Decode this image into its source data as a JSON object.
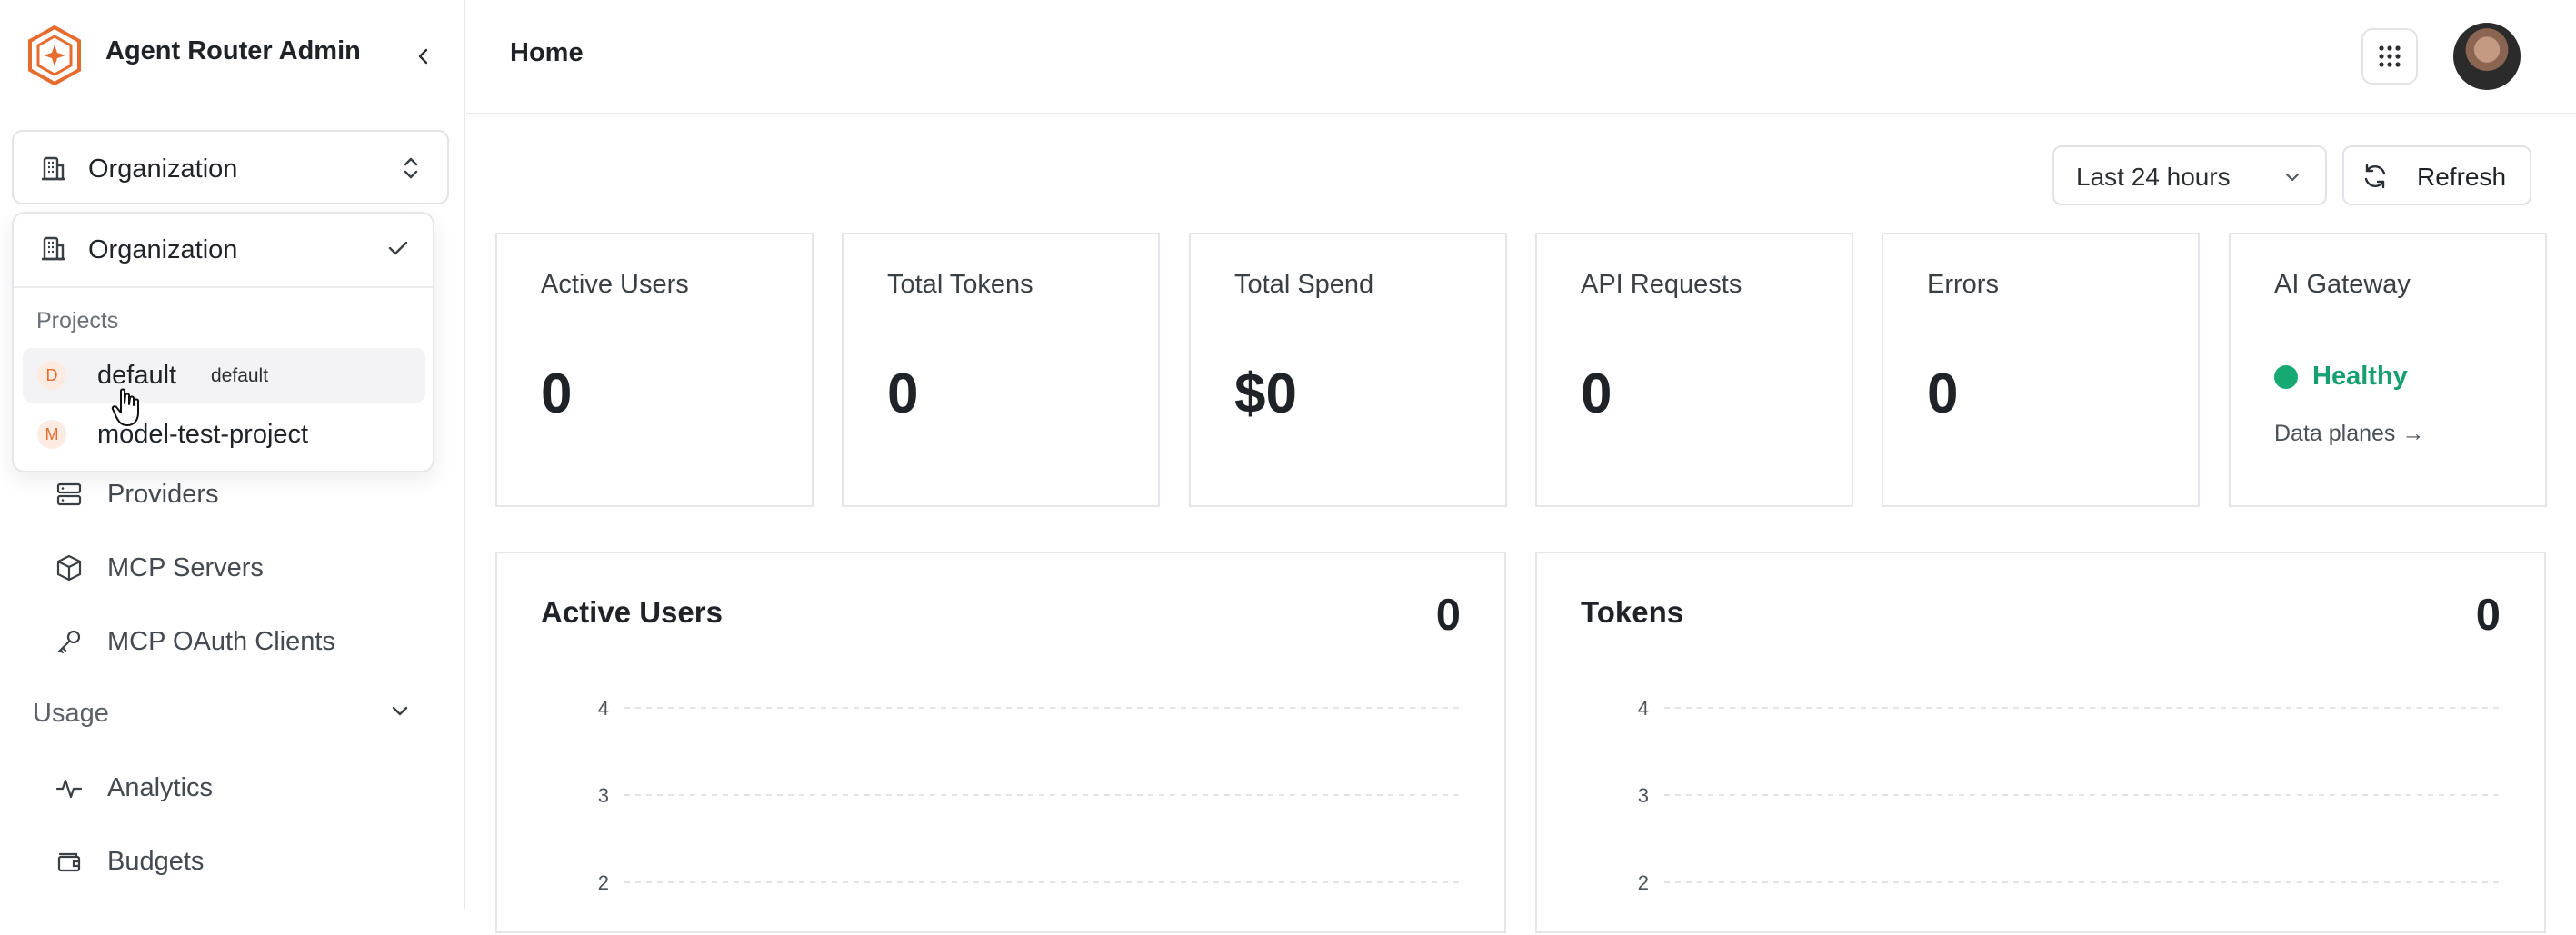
{
  "app": {
    "title": "Agent Router Admin",
    "brand_color": "#e56b2f"
  },
  "sidebar": {
    "scope_selector": {
      "value": "Organization"
    },
    "scope_menu": {
      "organization_label": "Organization",
      "projects_heading": "Projects",
      "projects": [
        {
          "initial": "D",
          "name": "default",
          "tag": "default",
          "active": true
        },
        {
          "initial": "M",
          "name": "model-test-project",
          "tag": "",
          "active": false
        }
      ]
    },
    "items": [
      {
        "label": "Providers",
        "icon": "server-icon"
      },
      {
        "label": "MCP Servers",
        "icon": "box-icon"
      },
      {
        "label": "MCP OAuth Clients",
        "icon": "key-icon"
      }
    ],
    "usage_group": {
      "label": "Usage",
      "items": [
        {
          "label": "Analytics",
          "icon": "activity-icon"
        },
        {
          "label": "Budgets",
          "icon": "wallet-icon"
        }
      ]
    }
  },
  "header": {
    "page_title": "Home"
  },
  "toolbar": {
    "time_range": "Last 24 hours",
    "refresh_label": "Refresh"
  },
  "kpis": [
    {
      "title": "Active Users",
      "value": "0"
    },
    {
      "title": "Total Tokens",
      "value": "0"
    },
    {
      "title": "Total Spend",
      "value": "$0"
    },
    {
      "title": "API Requests",
      "value": "0"
    },
    {
      "title": "Errors",
      "value": "0"
    }
  ],
  "gateway": {
    "title": "AI Gateway",
    "status": "Healthy",
    "status_color": "#16a974",
    "link": "Data planes →"
  },
  "chart_data": [
    {
      "type": "line",
      "title": "Active Users",
      "total": "0",
      "y_ticks": [
        "4",
        "3",
        "2"
      ],
      "grid": true
    },
    {
      "type": "line",
      "title": "Tokens",
      "total": "0",
      "y_ticks": [
        "4",
        "3",
        "2"
      ],
      "grid": true
    }
  ]
}
